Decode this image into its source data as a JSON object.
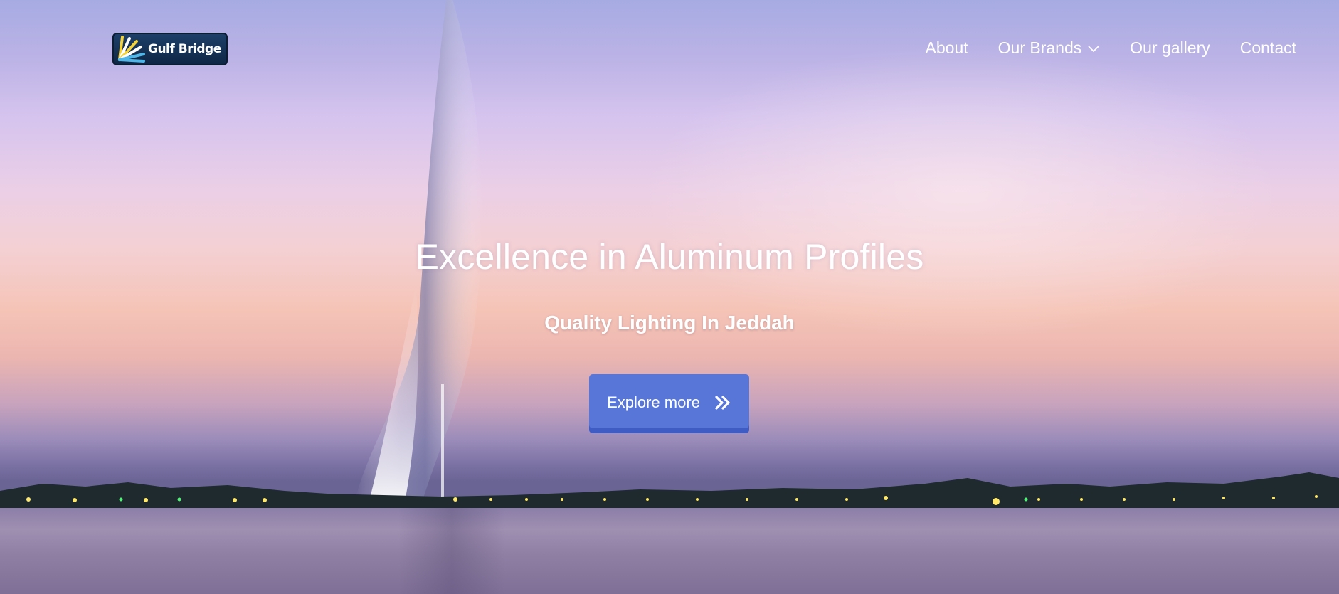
{
  "brand": {
    "name": "Gulf Bridge",
    "logo_icon": "sunburst-logo-icon",
    "colors": {
      "logo_bg": "#1d3f68",
      "ray_yellow": "#f3d23a",
      "ray_white": "#ffffff",
      "ray_blue": "#4fb6e8"
    }
  },
  "nav": {
    "items": [
      {
        "label": "About"
      },
      {
        "label": "Our Brands",
        "icon": "chevron-down-icon"
      },
      {
        "label": "Our gallery"
      },
      {
        "label": "Contact"
      }
    ]
  },
  "hero": {
    "title": "Excellence in Aluminum Profiles",
    "subtitle": "Quality Lighting In Jeddah",
    "cta_label": "Explore more",
    "cta_icon": "double-chevron-right-icon",
    "background": "fountain-at-dusk-photo"
  },
  "colors": {
    "accent": "#5875d8",
    "accent_dark": "#3f5bc4",
    "text": "#ffffff"
  }
}
